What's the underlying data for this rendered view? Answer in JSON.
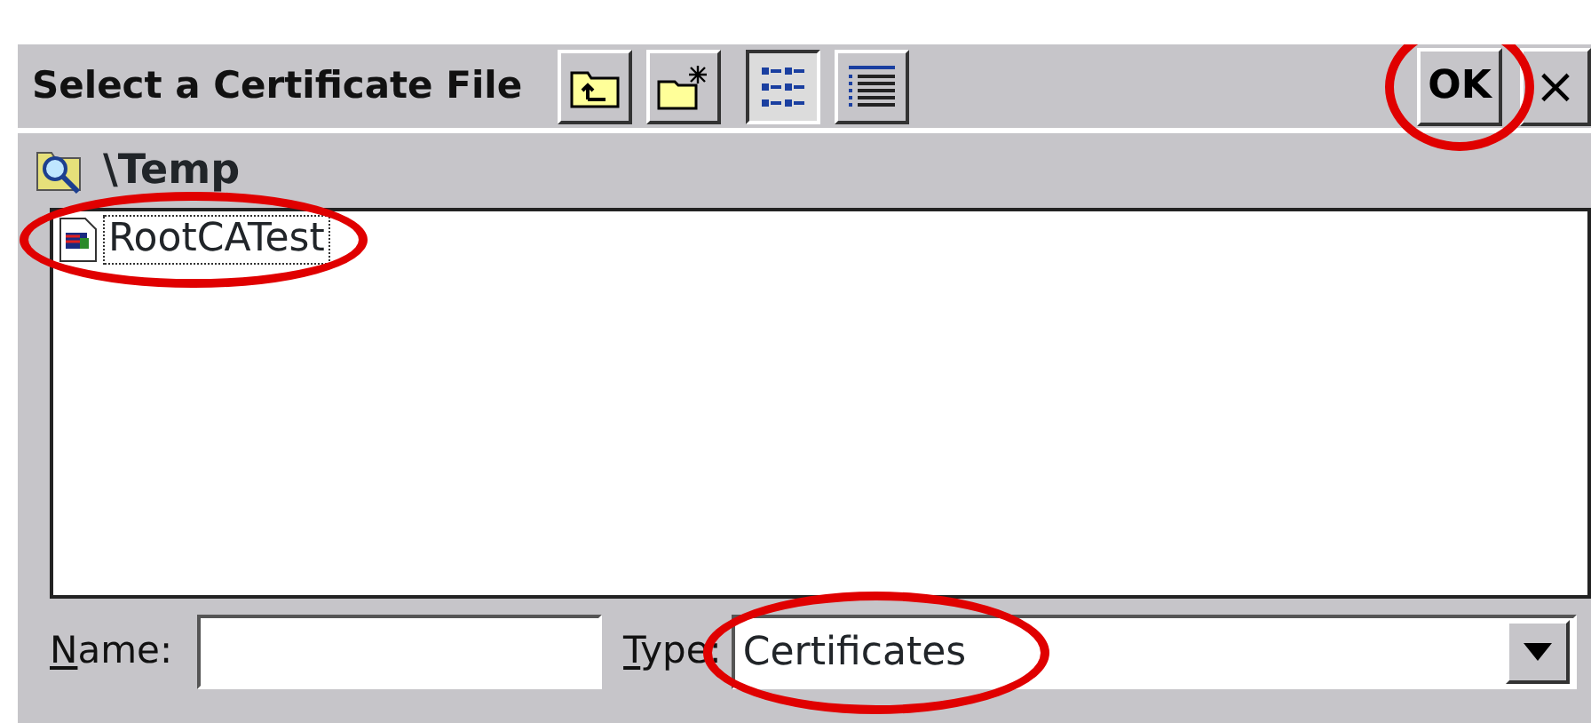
{
  "window": {
    "title": "Select a Certificate File"
  },
  "toolbar": [
    {
      "kind": "up-folder",
      "selected": false
    },
    {
      "kind": "new-folder",
      "selected": false
    },
    {
      "kind": "list-view",
      "selected": true
    },
    {
      "kind": "details-view",
      "selected": false
    }
  ],
  "ok_button": {
    "label": "OK",
    "highlighted": true
  },
  "close_button": {
    "label": "×"
  },
  "path": "\\Temp",
  "files": [
    {
      "name": "RootCATest",
      "focused": true,
      "highlighted": true
    }
  ],
  "name_field": {
    "label": "Name:",
    "underline_first": true
  },
  "type_field": {
    "label": "Type:",
    "underline_first": true,
    "value": "Certificates",
    "highlighted": true
  }
}
